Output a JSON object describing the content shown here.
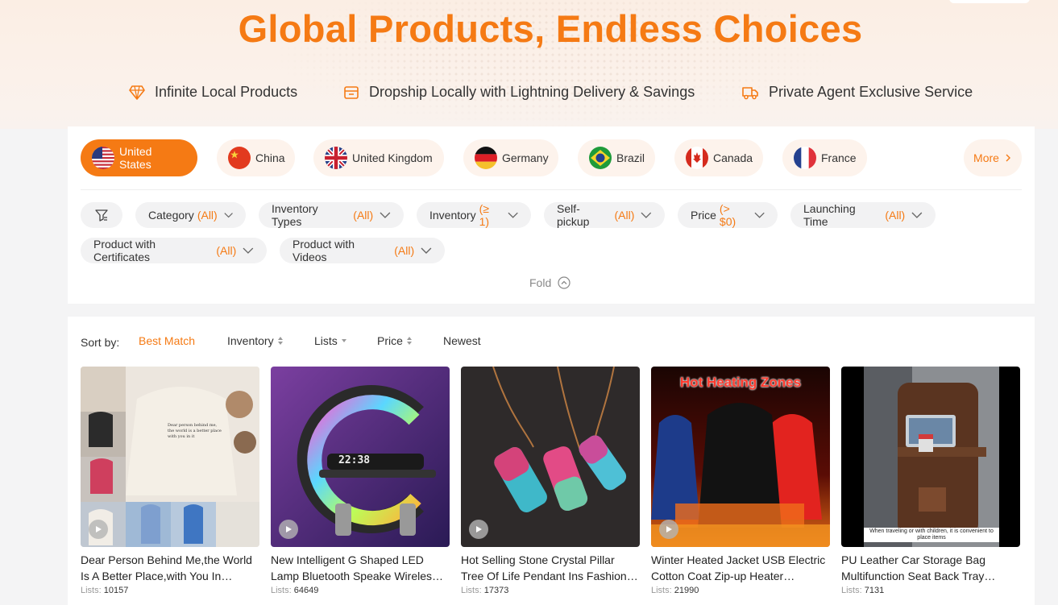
{
  "hero": {
    "title": "Global Products, Endless Choices",
    "features": [
      {
        "icon": "diamond-icon",
        "label": "Infinite Local Products"
      },
      {
        "icon": "delivery-box-icon",
        "label": "Dropship Locally with Lightning Delivery & Savings"
      },
      {
        "icon": "truck-icon",
        "label": "Private Agent Exclusive Service"
      }
    ]
  },
  "countries": [
    {
      "name": "United States",
      "flag": "us-flag-icon",
      "active": true
    },
    {
      "name": "China",
      "flag": "china-flag-icon"
    },
    {
      "name": "United Kingdom",
      "flag": "uk-flag-icon"
    },
    {
      "name": "Germany",
      "flag": "germany-flag-icon"
    },
    {
      "name": "Brazil",
      "flag": "brazil-flag-icon"
    },
    {
      "name": "Canada",
      "flag": "canada-flag-icon"
    },
    {
      "name": "France",
      "flag": "france-flag-icon"
    }
  ],
  "more_label": "More",
  "filters": [
    {
      "label": "Category",
      "value": "(All)"
    },
    {
      "label": "Inventory Types",
      "value": "(All)"
    },
    {
      "label": "Inventory",
      "value": "(≥ 1)"
    },
    {
      "label": "Self-pickup",
      "value": "(All)"
    },
    {
      "label": "Price",
      "value": "(> $0)"
    },
    {
      "label": "Launching Time",
      "value": "(All)"
    },
    {
      "label": "Product with Certificates",
      "value": "(All)"
    },
    {
      "label": "Product with Videos",
      "value": "(All)"
    }
  ],
  "fold_label": "Fold",
  "sort": {
    "label": "Sort by:",
    "options": [
      "Best Match",
      "Inventory",
      "Lists",
      "Price",
      "Newest"
    ],
    "active": "Best Match"
  },
  "products": [
    {
      "title": "Dear Person Behind Me,the World Is A Better Place,with You In…",
      "lists_label": "Lists:",
      "lists": "10157"
    },
    {
      "title": "New Intelligent G Shaped LED Lamp Bluetooth Speake Wireles…",
      "lists_label": "Lists:",
      "lists": "64649",
      "clock": "22:38"
    },
    {
      "title": "Hot Selling Stone Crystal Pillar Tree Of Life Pendant Ins Fashion…",
      "lists_label": "Lists:",
      "lists": "17373"
    },
    {
      "title": "Winter Heated Jacket USB Electric Cotton Coat Zip-up Heater…",
      "lists_label": "Lists:",
      "lists": "21990",
      "banner": "Hot Heating Zones"
    },
    {
      "title": "PU Leather Car Storage Bag Multifunction Seat Back Tray…",
      "lists_label": "Lists:",
      "lists": "7131",
      "caption": "When traveling or with children, it is convenient to place items"
    }
  ],
  "hoodie_text": "Dear person behind me, the world is a better place with you in it",
  "colors": {
    "accent": "#f57a14",
    "chip_bg": "#fdf3ec",
    "filter_bg": "#f2f2f3"
  }
}
